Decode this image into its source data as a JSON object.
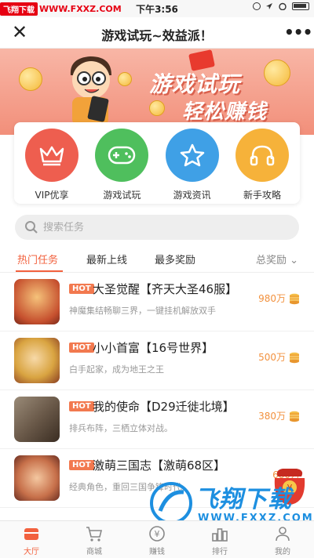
{
  "status_bar": {
    "watermark_badge": "飞翔下载",
    "watermark_url": "WWW.FXXZ.COM",
    "time": "下午3:56"
  },
  "nav": {
    "title": "游戏试玩~效益派！",
    "close_icon": "close-icon",
    "more_icon": "more-icon"
  },
  "banner": {
    "title": "游戏试玩",
    "subtitle": "轻松赚钱"
  },
  "categories": [
    {
      "label": "VIP优享",
      "icon": "crown-icon",
      "color": "#ee5e4f"
    },
    {
      "label": "游戏试玩",
      "icon": "gamepad-icon",
      "color": "#4fbf5d"
    },
    {
      "label": "游戏资讯",
      "icon": "star-icon",
      "color": "#3fa0e6"
    },
    {
      "label": "新手攻略",
      "icon": "headphones-icon",
      "color": "#f6b23a"
    }
  ],
  "search": {
    "placeholder": "搜索任务"
  },
  "tabs": {
    "items": [
      "热门任务",
      "最新上线",
      "最多奖励"
    ],
    "active": "热门任务",
    "sort_label": "总奖励"
  },
  "tasks": [
    {
      "badge": "HOT",
      "title": "大圣觉醒【齐天大圣46服】",
      "desc": "神魔集结畅聊三界，一键挂机解放双手",
      "reward": "980万",
      "thumb_color": "#c6502e"
    },
    {
      "badge": "HOT",
      "title": "小小首富【16号世界】",
      "desc": "白手起家，成为地王之王",
      "reward": "500万",
      "thumb_color": "#d9a441"
    },
    {
      "badge": "HOT",
      "title": "我的使命【D29迁徙北境】",
      "desc": "排兵布阵，三栖立体对战。",
      "reward": "380万",
      "thumb_color": "#6b5a4a"
    },
    {
      "badge": "HOT",
      "title": "激萌三国志【激萌68区】",
      "desc": "经典角色，重回三国争锋时代。",
      "reward": "680万",
      "thumb_color": "#c7704a"
    }
  ],
  "bottom_watermark": {
    "brand": "飞翔下载",
    "url": "WWW.FXXZ.COM"
  },
  "tabbar": [
    {
      "label": "大厅",
      "icon": "lobby-icon",
      "active": true
    },
    {
      "label": "商城",
      "icon": "cart-icon",
      "active": false
    },
    {
      "label": "赚钱",
      "icon": "money-icon",
      "active": false
    },
    {
      "label": "排行",
      "icon": "ranking-icon",
      "active": false
    },
    {
      "label": "我的",
      "icon": "profile-icon",
      "active": false
    }
  ],
  "colors": {
    "accent": "#f2613e",
    "reward": "#f2913e",
    "banner": "#f28f7a"
  }
}
